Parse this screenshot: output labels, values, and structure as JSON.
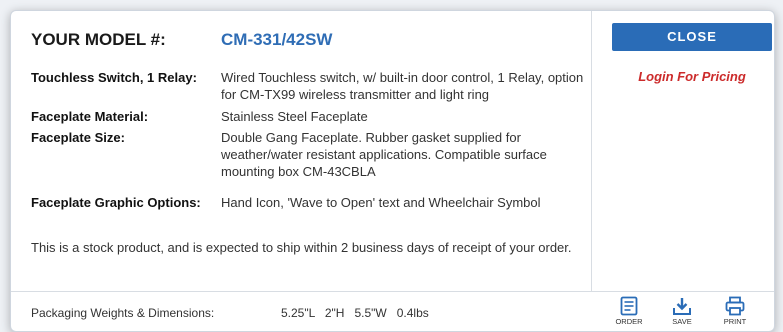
{
  "model": {
    "label": "YOUR MODEL #:",
    "value": "CM-331/42SW"
  },
  "specs": [
    {
      "key": "Touchless Switch, 1 Relay:",
      "value": "Wired Touchless switch, w/ built-in door control, 1 Relay, option for CM-TX99 wireless transmitter and light ring"
    },
    {
      "key": "Faceplate Material:",
      "value": "Stainless Steel Faceplate"
    },
    {
      "key": "Faceplate Size:",
      "value": "Double Gang Faceplate. Rubber gasket supplied for weather/water resistant applications. Compatible surface mounting box CM-43CBLA"
    },
    {
      "key": "Faceplate Graphic Options:",
      "value": "Hand Icon, 'Wave to Open' text and Wheelchair Symbol"
    }
  ],
  "stock_note": "This is a stock product, and is expected to ship within 2 business days of receipt of your order.",
  "side": {
    "close_label": "CLOSE",
    "login_label": "Login For Pricing"
  },
  "footer": {
    "packaging_label": "Packaging Weights & Dimensions:",
    "packaging_value": "5.25\"L   2\"H   5.5\"W   0.4lbs"
  },
  "actions": [
    {
      "label": "ORDER",
      "icon": "order-form-icon"
    },
    {
      "label": "SAVE",
      "icon": "download-icon"
    },
    {
      "label": "PRINT",
      "icon": "printer-icon"
    }
  ],
  "colors": {
    "accent": "#2a6cb7",
    "model": "#2f6db5",
    "login": "#cc2b2b"
  }
}
